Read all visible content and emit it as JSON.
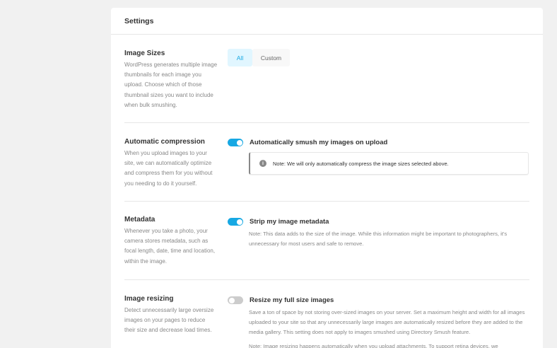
{
  "header": {
    "title": "Settings"
  },
  "image_sizes": {
    "label": "Image Sizes",
    "description": "WordPress generates multiple image thumbnails for each image you upload. Choose which of those thumbnail sizes you want to include when bulk smushing.",
    "tabs": [
      {
        "label": "All",
        "active": true
      },
      {
        "label": "Custom",
        "active": false
      }
    ]
  },
  "auto_compression": {
    "label": "Automatic compression",
    "description": "When you upload images to your site, we can automatically optimize and compress them for you without you needing to do it yourself.",
    "toggle_label": "Automatically smush my images on upload",
    "toggle_on": true,
    "notice": "Note: We will only automatically compress the image sizes selected above."
  },
  "metadata": {
    "label": "Metadata",
    "description": "Whenever you take a photo, your camera stores metadata, such as focal length, date, time and location, within the image.",
    "toggle_label": "Strip my image metadata",
    "toggle_on": true,
    "note": "Note: This data adds to the size of the image. While this information might be important to photographers, it's unnecessary for most users and safe to remove."
  },
  "image_resizing": {
    "label": "Image resizing",
    "description": "Detect unnecessarily large oversize images on your pages to reduce their size and decrease load times.",
    "toggle_label": "Resize my full size images",
    "toggle_on": false,
    "note": "Save a ton of space by not storing over-sized images on your server. Set a maximum height and width for all images uploaded to your site so that any unnecessarily large images are automatically resized before they are added to the media gallery. This setting does not apply to images smushed using Directory Smush feature.",
    "note2": "Note: Image resizing happens automatically when you upload attachments. To support retina devices, we"
  },
  "colors": {
    "accent": "#17a8e3",
    "accent_light": "#e1f6ff",
    "toggle_off": "#cccccc"
  }
}
